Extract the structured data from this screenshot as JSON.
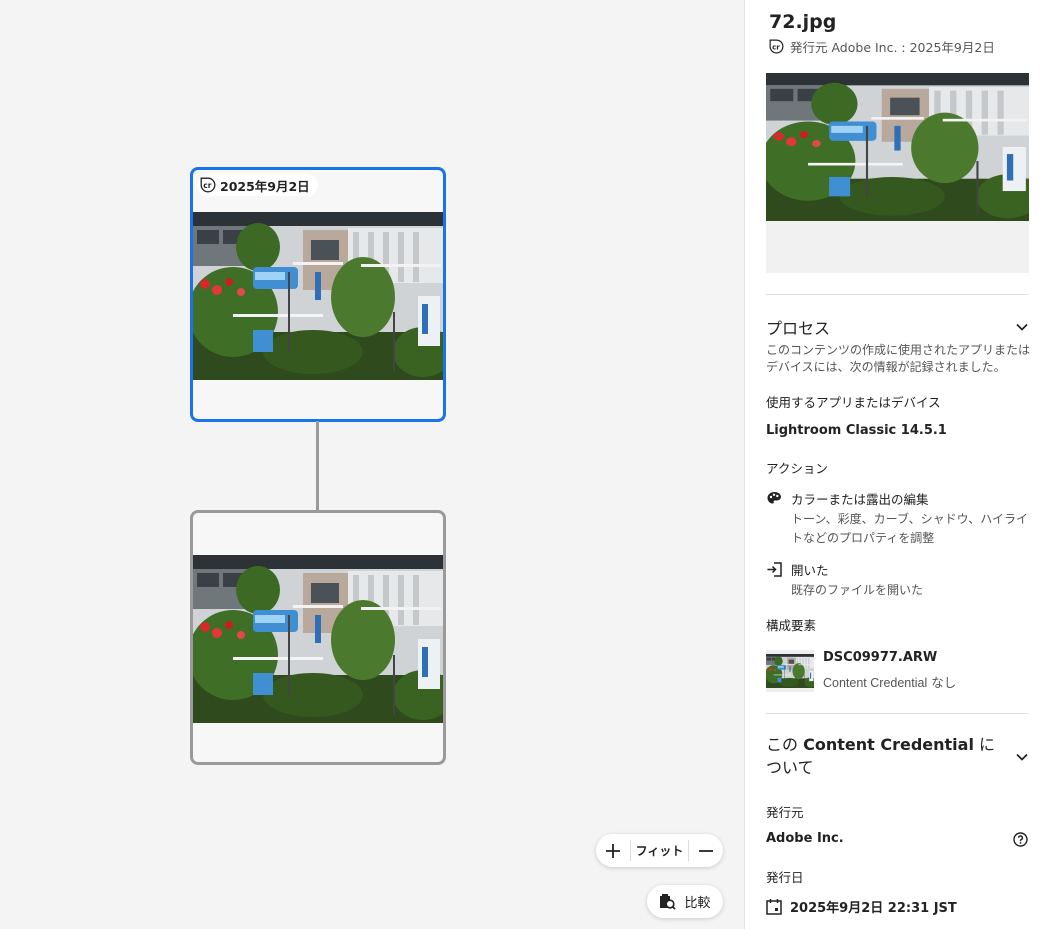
{
  "canvas": {
    "selected_node": {
      "date": "2025年9月2日"
    },
    "zoom": {
      "fit_label": "フィット"
    },
    "compare_label": "比較"
  },
  "panel": {
    "file_name": "72.jpg",
    "issuer_line": "発行元 Adobe Inc. : 2025年9月2日",
    "process": {
      "title": "プロセス",
      "description": "このコンテンツの作成に使用されたアプリまたはデバイスには、次の情報が記録されました。",
      "app_label": "使用するアプリまたはデバイス",
      "app_value": "Lightroom Classic 14.5.1",
      "actions_label": "アクション",
      "actions": [
        {
          "title": "カラーまたは露出の編集",
          "description": "トーン、彩度、カーブ、シャドウ、ハイライトなどのプロパティを調整",
          "icon": "palette-icon"
        },
        {
          "title": "開いた",
          "description": "既存のファイルを開いた",
          "icon": "open-file-icon"
        }
      ],
      "ingredients_label": "構成要素",
      "ingredient": {
        "name": "DSC09977.ARW",
        "cc_term": "Content Credential",
        "cc_status": "なし"
      }
    },
    "about": {
      "title_prefix": "この",
      "title_strong": "Content Credential",
      "title_suffix": "について",
      "issuer_label": "発行元",
      "issuer_value": "Adobe Inc.",
      "issued_label": "発行日",
      "issued_value": "2025年9月2日 22:31 JST"
    }
  },
  "colors": {
    "selected_border": "#1a73e8",
    "parent_border": "#9a9a9a"
  }
}
